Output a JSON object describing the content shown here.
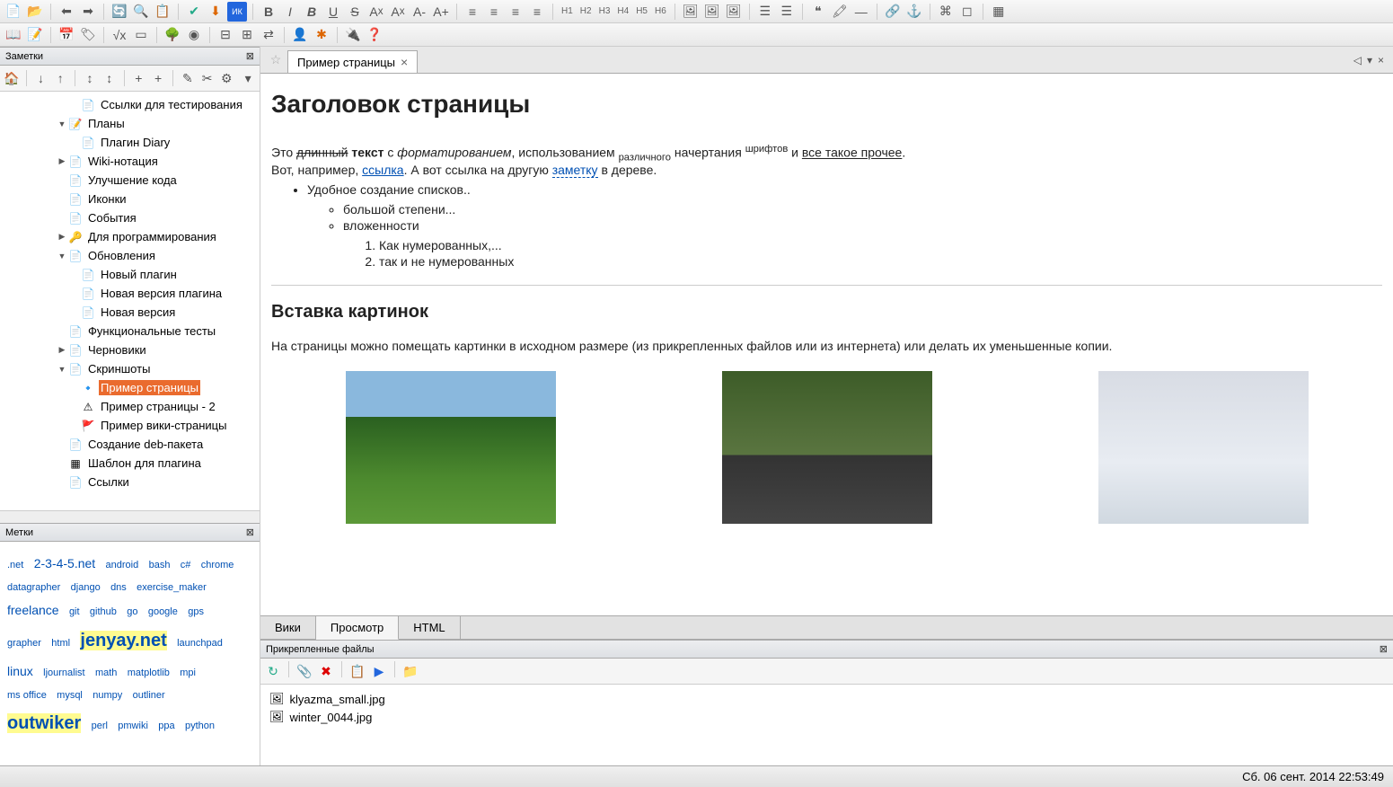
{
  "panels": {
    "notes_title": "Заметки",
    "tags_title": "Метки",
    "attachments_title": "Прикрепленные файлы"
  },
  "page_tab": {
    "title": "Пример страницы"
  },
  "tree": [
    {
      "label": "Ссылки для тестирования",
      "indent": 2,
      "arrow": "",
      "icon": "page"
    },
    {
      "label": "Планы",
      "indent": 1,
      "arrow": "▼",
      "icon": "edit"
    },
    {
      "label": "Плагин Diary",
      "indent": 2,
      "arrow": "",
      "icon": "page"
    },
    {
      "label": "Wiki-нотация",
      "indent": 1,
      "arrow": "▶",
      "icon": "page"
    },
    {
      "label": "Улучшение кода",
      "indent": 1,
      "arrow": "",
      "icon": "page"
    },
    {
      "label": "Иконки",
      "indent": 1,
      "arrow": "",
      "icon": "page"
    },
    {
      "label": "События",
      "indent": 1,
      "arrow": "",
      "icon": "page"
    },
    {
      "label": "Для программирования",
      "indent": 1,
      "arrow": "▶",
      "icon": "key"
    },
    {
      "label": "Обновления",
      "indent": 1,
      "arrow": "▼",
      "icon": "page"
    },
    {
      "label": "Новый плагин",
      "indent": 2,
      "arrow": "",
      "icon": "page"
    },
    {
      "label": "Новая версия плагина",
      "indent": 2,
      "arrow": "",
      "icon": "page"
    },
    {
      "label": "Новая версия",
      "indent": 2,
      "arrow": "",
      "icon": "page"
    },
    {
      "label": "Функциональные тесты",
      "indent": 1,
      "arrow": "",
      "icon": "page"
    },
    {
      "label": "Черновики",
      "indent": 1,
      "arrow": "▶",
      "icon": "page"
    },
    {
      "label": "Скриншоты",
      "indent": 1,
      "arrow": "▼",
      "icon": "page"
    },
    {
      "label": "Пример страницы",
      "indent": 2,
      "arrow": "",
      "icon": "blue",
      "selected": true
    },
    {
      "label": "Пример страницы - 2",
      "indent": 2,
      "arrow": "",
      "icon": "warn"
    },
    {
      "label": "Пример вики-страницы",
      "indent": 2,
      "arrow": "",
      "icon": "flag"
    },
    {
      "label": "Создание deb-пакета",
      "indent": 1,
      "arrow": "",
      "icon": "page"
    },
    {
      "label": "Шаблон для плагина",
      "indent": 1,
      "arrow": "",
      "icon": "grid"
    },
    {
      "label": "Ссылки",
      "indent": 1,
      "arrow": "",
      "icon": "page"
    }
  ],
  "tags": [
    {
      "t": ".net",
      "s": 0
    },
    {
      "t": "2-3-4-5.net",
      "s": 2
    },
    {
      "t": "android",
      "s": 0
    },
    {
      "t": "bash",
      "s": 0
    },
    {
      "t": "c#",
      "s": 0
    },
    {
      "t": "chrome",
      "s": 0
    },
    {
      "t": "datagrapher",
      "s": 0
    },
    {
      "t": "django",
      "s": 0
    },
    {
      "t": "dns",
      "s": 0
    },
    {
      "t": "exercise_maker",
      "s": 0
    },
    {
      "t": "freelance",
      "s": 2
    },
    {
      "t": "git",
      "s": 0
    },
    {
      "t": "github",
      "s": 0
    },
    {
      "t": "go",
      "s": 0
    },
    {
      "t": "google",
      "s": 0
    },
    {
      "t": "gps",
      "s": 0
    },
    {
      "t": "grapher",
      "s": 0
    },
    {
      "t": "html",
      "s": 0
    },
    {
      "t": "jenyay.net",
      "s": 3
    },
    {
      "t": "launchpad",
      "s": 0
    },
    {
      "t": "linux",
      "s": 2
    },
    {
      "t": "ljournalist",
      "s": 0
    },
    {
      "t": "math",
      "s": 0
    },
    {
      "t": "matplotlib",
      "s": 0
    },
    {
      "t": "mpi",
      "s": 0
    },
    {
      "t": "ms office",
      "s": 0
    },
    {
      "t": "mysql",
      "s": 0
    },
    {
      "t": "numpy",
      "s": 0
    },
    {
      "t": "outliner",
      "s": 0
    },
    {
      "t": "outwiker",
      "s": 3
    },
    {
      "t": "perl",
      "s": 0
    },
    {
      "t": "pmwiki",
      "s": 0
    },
    {
      "t": "ppa",
      "s": 0
    },
    {
      "t": "python",
      "s": 0
    }
  ],
  "content": {
    "h1": "Заголовок страницы",
    "p1_a": "Это ",
    "p1_strike": "длинный",
    "p1_b": " текст",
    "p1_c": " с ",
    "p1_em": "форматированием",
    "p1_d": ", использованием ",
    "p1_sub": "различного",
    "p1_e": " начертания ",
    "p1_sup": "шрифтов",
    "p1_f": " и ",
    "p1_u": "все такое прочее",
    "p1_g": ".",
    "p2_a": "Вот, например, ",
    "p2_link1": "ссылка",
    "p2_b": ". А вот ссылка на другую ",
    "p2_link2": "заметку",
    "p2_c": " в дереве.",
    "li1": "Удобное создание списков..",
    "li2": "большой степени...",
    "li3": "вложенности",
    "ol1": "Как нумерованных,...",
    "ol2": "так и не нумерованных",
    "h2": "Вставка картинок",
    "p3": "На страницы можно помещать картинки в исходном размере (из прикрепленных файлов или из интернета) или делать их уменьшенные копии."
  },
  "view_tabs": {
    "t0": "Вики",
    "t1": "Просмотр",
    "t2": "HTML"
  },
  "attachments": [
    {
      "name": "klyazma_small.jpg"
    },
    {
      "name": "winter_0044.jpg"
    }
  ],
  "headings": {
    "h1": "H1",
    "h2": "H2",
    "h3": "H3",
    "h4": "H4",
    "h5": "H5",
    "h6": "H6"
  },
  "status": "Сб. 06 сент. 2014 22:53:49"
}
